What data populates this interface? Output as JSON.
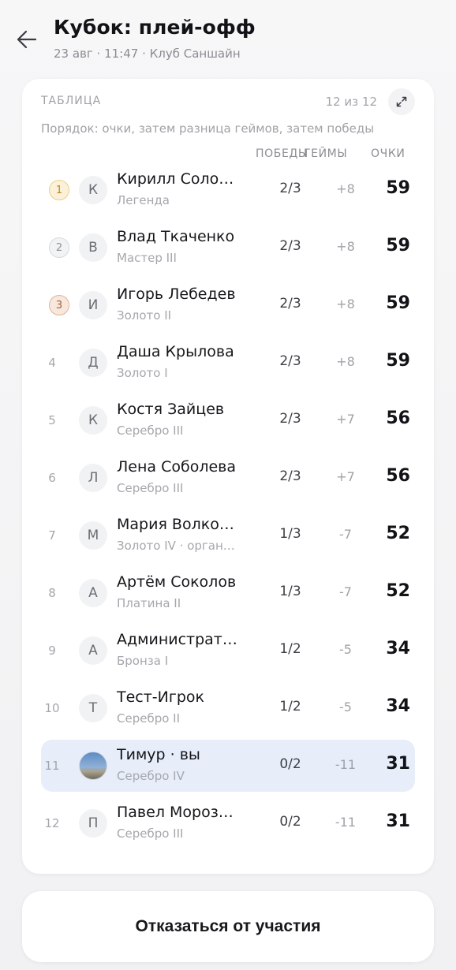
{
  "header": {
    "title": "Кубок: плей-офф",
    "subtitle": "23 авг · 11:47 · Клуб Саншайн"
  },
  "table": {
    "section_label": "ТАБЛИЦА",
    "count": "12 из 12",
    "order_note": "Порядок: очки, затем разница геймов, затем победы",
    "columns": {
      "wins": "ПОБЕДЫ",
      "games": "ГЕЙМЫ",
      "points": "ОЧКИ"
    },
    "rows": [
      {
        "rank": "1",
        "medal": "gold",
        "initial": "К",
        "name": "Кирилл Соло…",
        "league": "Легенда",
        "wins": "2/3",
        "diff": "+8",
        "points": "59"
      },
      {
        "rank": "2",
        "medal": "silver",
        "initial": "В",
        "name": "Влад Ткаченко",
        "league": "Мастер III",
        "wins": "2/3",
        "diff": "+8",
        "points": "59"
      },
      {
        "rank": "3",
        "medal": "bronze",
        "initial": "И",
        "name": "Игорь Лебедев",
        "league": "Золото II",
        "wins": "2/3",
        "diff": "+8",
        "points": "59"
      },
      {
        "rank": "4",
        "medal": "",
        "initial": "Д",
        "name": "Даша Крылова",
        "league": "Золото I",
        "wins": "2/3",
        "diff": "+8",
        "points": "59"
      },
      {
        "rank": "5",
        "medal": "",
        "initial": "К",
        "name": "Костя Зайцев",
        "league": "Серебро III",
        "wins": "2/3",
        "diff": "+7",
        "points": "56"
      },
      {
        "rank": "6",
        "medal": "",
        "initial": "Л",
        "name": "Лена Соболева",
        "league": "Серебро III",
        "wins": "2/3",
        "diff": "+7",
        "points": "56"
      },
      {
        "rank": "7",
        "medal": "",
        "initial": "М",
        "name": "Мария Волко…",
        "league": "Золото IV · орган…",
        "wins": "1/3",
        "diff": "-7",
        "points": "52"
      },
      {
        "rank": "8",
        "medal": "",
        "initial": "А",
        "name": "Артём Соколов",
        "league": "Платина II",
        "wins": "1/3",
        "diff": "-7",
        "points": "52"
      },
      {
        "rank": "9",
        "medal": "",
        "initial": "А",
        "name": "Администрат…",
        "league": "Бронза I",
        "wins": "1/2",
        "diff": "-5",
        "points": "34"
      },
      {
        "rank": "10",
        "medal": "",
        "initial": "Т",
        "name": "Тест-Игрок",
        "league": "Серебро II",
        "wins": "1/2",
        "diff": "-5",
        "points": "34"
      },
      {
        "rank": "11",
        "medal": "",
        "initial": "",
        "photo": true,
        "you": true,
        "name": "Тимур · вы",
        "league": "Серебро IV",
        "wins": "0/2",
        "diff": "-11",
        "points": "31"
      },
      {
        "rank": "12",
        "medal": "",
        "initial": "П",
        "name": "Павел Мороз…",
        "league": "Серебро III",
        "wins": "0/2",
        "diff": "-11",
        "points": "31"
      }
    ]
  },
  "withdraw_label": "Отказаться от участия",
  "icons": {
    "back": "arrow-left-icon",
    "expand": "expand-icon"
  },
  "colors": {
    "highlight_row": "#e7eefa",
    "gold": "#ecd08c",
    "silver": "#d7d9dd",
    "bronze": "#dfb497"
  }
}
